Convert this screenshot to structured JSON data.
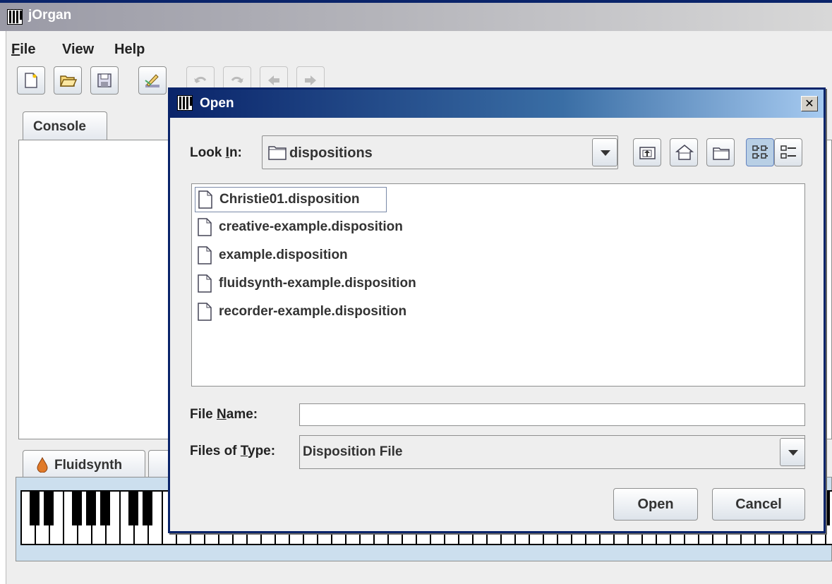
{
  "main_window": {
    "title": "jOrgan",
    "menu": [
      {
        "label": "File",
        "mnemonic": "F",
        "rest": "ile"
      },
      {
        "label": "View"
      },
      {
        "label": "Help"
      }
    ],
    "toolbar_icons": [
      "new-icon",
      "open-folder-icon",
      "save-icon",
      "configure-icon",
      "undo-icon",
      "redo-icon",
      "back-icon",
      "forward-icon"
    ],
    "console_tab": "Console",
    "keyboard_tab": "Fluidsynth"
  },
  "dialog": {
    "title": "Open",
    "close_glyph": "✕",
    "look_in_label_pre": "Look ",
    "look_in_label_mnemonic": "I",
    "look_in_label_post": "n:",
    "look_in_value": "dispositions",
    "nav_icons": [
      "up-folder-icon",
      "home-icon",
      "new-folder-icon",
      "list-view-icon",
      "details-view-icon"
    ],
    "files": [
      "Christie01.disposition",
      "creative-example.disposition",
      "example.disposition",
      "fluidsynth-example.disposition",
      "recorder-example.disposition"
    ],
    "selected_file_index": 0,
    "file_name_label_pre": "File ",
    "file_name_label_mnemonic": "N",
    "file_name_label_post": "ame:",
    "file_name_value": "",
    "files_of_type_label_pre": "Files of ",
    "files_of_type_label_mnemonic": "T",
    "files_of_type_label_post": "ype:",
    "files_of_type_value": "Disposition File",
    "open_button": "Open",
    "cancel_button": "Cancel"
  },
  "colors": {
    "active_title": "#0a246a",
    "inactive_title": "#9a9aa6",
    "keyboard_bg": "#ccdfee"
  }
}
